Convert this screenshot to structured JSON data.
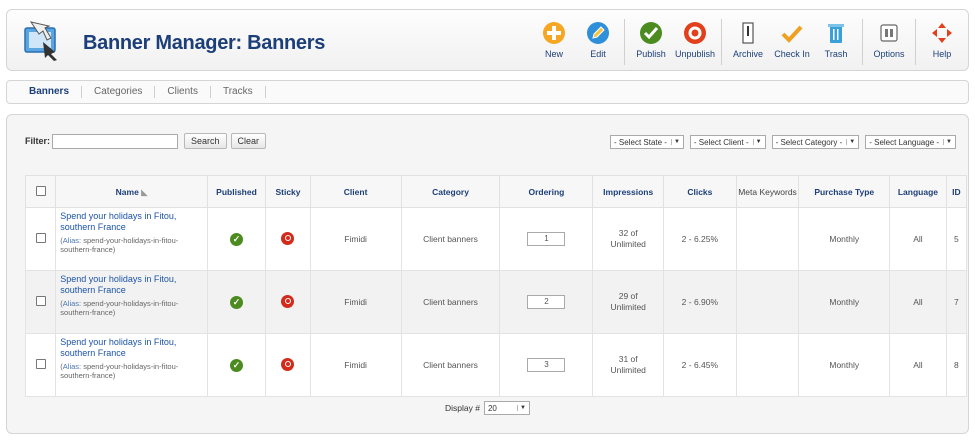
{
  "header": {
    "title": "Banner Manager: Banners"
  },
  "toolbar": {
    "new": "New",
    "edit": "Edit",
    "publish": "Publish",
    "unpublish": "Unpublish",
    "archive": "Archive",
    "checkin": "Check In",
    "trash": "Trash",
    "options": "Options",
    "help": "Help"
  },
  "tabs": [
    "Banners",
    "Categories",
    "Clients",
    "Tracks"
  ],
  "filter": {
    "label": "Filter:",
    "value": "",
    "search": "Search",
    "clear": "Clear"
  },
  "selects": {
    "state": "- Select State -",
    "client": "- Select Client -",
    "category": "- Select Category -",
    "language": "- Select Language -"
  },
  "columns": [
    "Name",
    "Published",
    "Sticky",
    "Client",
    "Category",
    "Ordering",
    "Impressions",
    "Clicks",
    "Meta Keywords",
    "Purchase Type",
    "Language",
    "ID"
  ],
  "rows": [
    {
      "name": "Spend your holidays in Fitou, southern France",
      "alias_label": "Alias",
      "alias": ": spend-your-holidays-in-fitou-southern-france)",
      "client": "Fimidi",
      "category": "Client banners",
      "ordering": "1",
      "impressions_1": "32 of",
      "impressions_2": "Unlimited",
      "clicks": "2 - 6.25%",
      "meta": "",
      "purchase": "Monthly",
      "language": "All",
      "id": "5"
    },
    {
      "name": "Spend your holidays in Fitou, southern France",
      "alias_label": "Alias",
      "alias": ": spend-your-holidays-in-fitou-southern-france)",
      "client": "Fimidi",
      "category": "Client banners",
      "ordering": "2",
      "impressions_1": "29 of",
      "impressions_2": "Unlimited",
      "clicks": "2 - 6.90%",
      "meta": "",
      "purchase": "Monthly",
      "language": "All",
      "id": "7"
    },
    {
      "name": "Spend your holidays in Fitou, southern France",
      "alias_label": "Alias",
      "alias": ": spend-your-holidays-in-fitou-southern-france)",
      "client": "Fimidi",
      "category": "Client banners",
      "ordering": "3",
      "impressions_1": "31 of",
      "impressions_2": "Unlimited",
      "clicks": "2 - 6.45%",
      "meta": "",
      "purchase": "Monthly",
      "language": "All",
      "id": "8"
    }
  ],
  "footer": {
    "display_label": "Display #",
    "display_value": "20"
  },
  "colors": {
    "title": "#1c3f7a",
    "link": "#1c54a5",
    "new": "#f5a623",
    "edit": "#2f8fd8",
    "publish": "#4b8b1f",
    "unpublish": "#e2401c",
    "checkin": "#f0a020",
    "trash": "#3aa0d8"
  }
}
